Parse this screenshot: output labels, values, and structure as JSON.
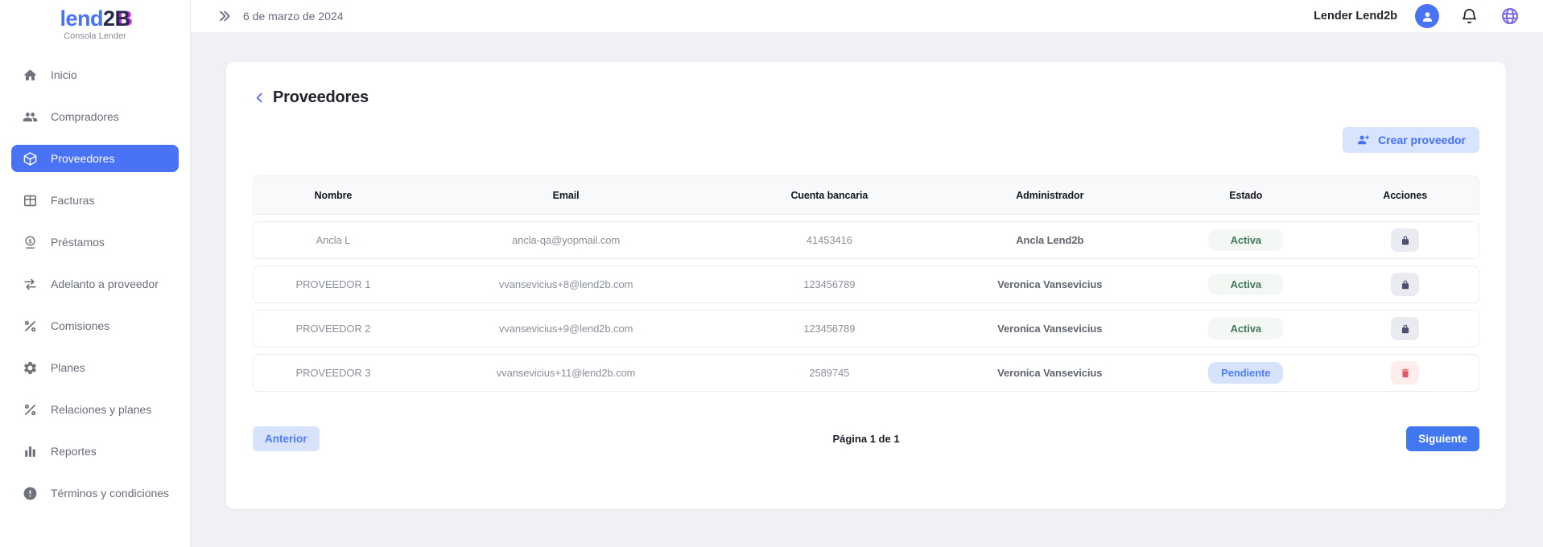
{
  "brand": {
    "logo_part1": "lend",
    "logo_part2": "2",
    "logo_part3": "B",
    "subtitle": "Consola Lender"
  },
  "topbar": {
    "date": "6 de marzo de 2024",
    "user_name": "Lender Lend2b"
  },
  "sidebar": {
    "items": [
      {
        "label": "Inicio",
        "icon": "home-icon",
        "active": false
      },
      {
        "label": "Compradores",
        "icon": "people-icon",
        "active": false
      },
      {
        "label": "Proveedores",
        "icon": "package-icon",
        "active": true
      },
      {
        "label": "Facturas",
        "icon": "table-icon",
        "active": false
      },
      {
        "label": "Préstamos",
        "icon": "coin-icon",
        "active": false
      },
      {
        "label": "Adelanto a proveedor",
        "icon": "swap-arrows-icon",
        "active": false
      },
      {
        "label": "Comisiones",
        "icon": "percent-icon",
        "active": false
      },
      {
        "label": "Planes",
        "icon": "gear-icon",
        "active": false
      },
      {
        "label": "Relaciones y planes",
        "icon": "percent-icon",
        "active": false
      },
      {
        "label": "Reportes",
        "icon": "bar-chart-icon",
        "active": false
      },
      {
        "label": "Términos y condiciones",
        "icon": "alert-circle-icon",
        "active": false
      }
    ]
  },
  "page": {
    "title": "Proveedores",
    "create_button_label": "Crear proveedor"
  },
  "table": {
    "headers": [
      "Nombre",
      "Email",
      "Cuenta bancaria",
      "Administrador",
      "Estado",
      "Acciones"
    ],
    "rows": [
      {
        "nombre": "Ancla L",
        "email": "ancla-qa@yopmail.com",
        "cuenta_bancaria": "41453416",
        "administrador": "Ancla Lend2b",
        "estado": "Activa",
        "estado_tipo": "activa",
        "accion": "lock"
      },
      {
        "nombre": "PROVEEDOR 1",
        "email": "vvansevicius+8@lend2b.com",
        "cuenta_bancaria": "123456789",
        "administrador": "Veronica Vansevicius",
        "estado": "Activa",
        "estado_tipo": "activa",
        "accion": "lock"
      },
      {
        "nombre": "PROVEEDOR 2",
        "email": "vvansevicius+9@lend2b.com",
        "cuenta_bancaria": "123456789",
        "administrador": "Veronica Vansevicius",
        "estado": "Activa",
        "estado_tipo": "activa",
        "accion": "lock"
      },
      {
        "nombre": "PROVEEDOR 3",
        "email": "vvansevicius+11@lend2b.com",
        "cuenta_bancaria": "2589745",
        "administrador": "Veronica Vansevicius",
        "estado": "Pendiente",
        "estado_tipo": "pendiente",
        "accion": "trash"
      }
    ]
  },
  "pagination": {
    "previous_label": "Anterior",
    "page_info": "Página 1 de 1",
    "next_label": "Siguiente"
  },
  "colors": {
    "accent_blue": "#4a72f5",
    "light_blue_button_bg": "#d7e3fb",
    "solid_blue_button_bg": "#4277f2",
    "badge_active_bg": "#f4f8f5",
    "badge_active_text": "#42795c",
    "badge_pending_bg": "#d7e3fb",
    "badge_pending_text": "#4f7cf8",
    "danger_red": "#e35763",
    "globe_purple": "#7a68e8",
    "logo_magenta": "#c92ddd"
  }
}
